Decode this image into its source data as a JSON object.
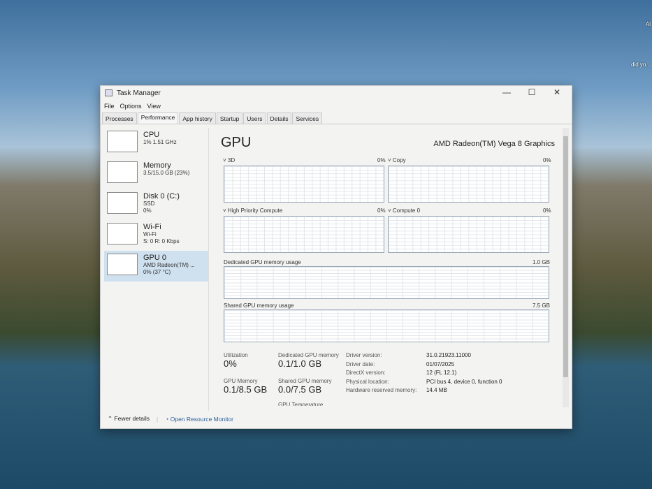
{
  "desktop": {
    "icons": [
      "Al",
      "did yo..."
    ]
  },
  "window": {
    "title": "Task Manager",
    "menu": [
      "File",
      "Options",
      "View"
    ],
    "tabs": [
      "Processes",
      "Performance",
      "App history",
      "Startup",
      "Users",
      "Details",
      "Services"
    ],
    "active_tab": "Performance"
  },
  "sidebar": [
    {
      "title": "CPU",
      "line1": "1% 1.51 GHz",
      "line2": ""
    },
    {
      "title": "Memory",
      "line1": "3.5/15.0 GB (23%)",
      "line2": ""
    },
    {
      "title": "Disk 0 (C:)",
      "line1": "SSD",
      "line2": "0%"
    },
    {
      "title": "Wi-Fi",
      "line1": "Wi-Fi",
      "line2": "S: 0 R: 0 Kbps"
    },
    {
      "title": "GPU 0",
      "line1": "AMD Radeon(TM) ...",
      "line2": "0% (37 °C)"
    }
  ],
  "gpu": {
    "title": "GPU",
    "name": "AMD Radeon(TM) Vega 8 Graphics",
    "graphs": {
      "g3d": {
        "label": "3D",
        "value": "0%"
      },
      "copy": {
        "label": "Copy",
        "value": "0%"
      },
      "hpc": {
        "label": "High Priority Compute",
        "value": "0%"
      },
      "compute": {
        "label": "Compute 0",
        "value": "0%"
      },
      "dedicated": {
        "label": "Dedicated GPU memory usage",
        "max": "1.0 GB"
      },
      "shared": {
        "label": "Shared GPU memory usage",
        "max": "7.5 GB"
      }
    },
    "stats": {
      "util_label": "Utilization",
      "util": "0%",
      "dedmem_label": "Dedicated GPU memory",
      "dedmem": "0.1/1.0 GB",
      "gpumem_label": "GPU Memory",
      "gpumem": "0.1/8.5 GB",
      "shmem_label": "Shared GPU memory",
      "shmem": "0.0/7.5 GB",
      "temp_label": "GPU Temperature"
    },
    "details": [
      [
        "Driver version:",
        "31.0.21923.11000"
      ],
      [
        "Driver date:",
        "01/07/2025"
      ],
      [
        "DirectX version:",
        "12 (FL 12.1)"
      ],
      [
        "Physical location:",
        "PCI bus 4, device 0, function 0"
      ],
      [
        "Hardware reserved memory:",
        "14.4 MB"
      ]
    ]
  },
  "footer": {
    "fewer": "Fewer details",
    "monitor": "Open Resource Monitor"
  }
}
